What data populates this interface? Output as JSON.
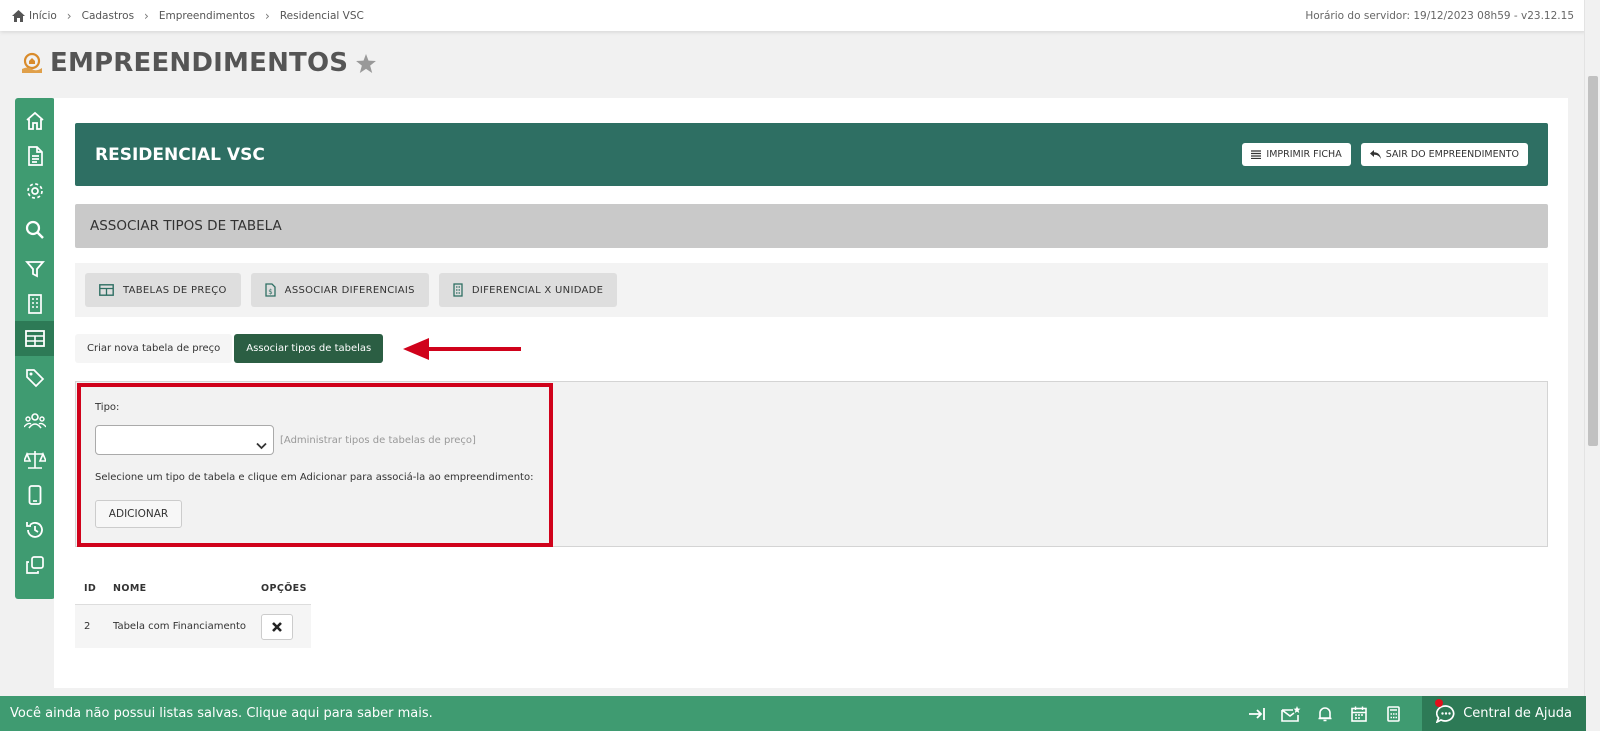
{
  "breadcrumb": {
    "items": [
      "Início",
      "Cadastros",
      "Empreendimentos",
      "Residencial VSC"
    ],
    "server_time": "Horário do servidor: 19/12/2023 08h59 - v23.12.15"
  },
  "page": {
    "title": "EMPREENDIMENTOS"
  },
  "sidebar": {
    "icons": [
      "home-icon",
      "document-icon",
      "gear-icon",
      "search-icon",
      "filter-icon",
      "building-icon",
      "table-icon",
      "tag-icon",
      "users-icon",
      "scale-icon",
      "mobile-icon",
      "history-icon",
      "copy-icon"
    ],
    "active_index": 6
  },
  "header": {
    "name": "RESIDENCIAL VSC",
    "print_label": "IMPRIMIR FICHA",
    "exit_label": "SAIR DO EMPREENDIMENTO"
  },
  "section": {
    "title": "ASSOCIAR TIPOS DE TABELA"
  },
  "tabs": {
    "price_tables": "TABELAS DE PREÇO",
    "associate_diff": "ASSOCIAR DIFERENCIAIS",
    "diff_unit": "DIFERENCIAL X UNIDADE"
  },
  "subtabs": {
    "create": "Criar nova tabela de preço",
    "associate": "Associar tipos de tabelas"
  },
  "form": {
    "tipo_label": "Tipo:",
    "tipo_value": "",
    "admin_link": "[Administrar tipos de tabelas de preço]",
    "help": "Selecione um tipo de tabela e clique em Adicionar para associá-la ao empreendimento:",
    "add_label": "ADICIONAR"
  },
  "table": {
    "headers": {
      "id": "ID",
      "name": "NOME",
      "options": "OPÇÕES"
    },
    "rows": [
      {
        "id": "2",
        "name": "Tabela com Financiamento"
      }
    ]
  },
  "bottombar": {
    "message": "Você ainda não possui listas salvas. Clique aqui para saber mais.",
    "help_label": "Central de Ajuda"
  },
  "colors": {
    "sidebar": "#3f9b71",
    "header": "#2e6f63",
    "active_subtab": "#2b5e43",
    "highlight": "#d0021b"
  }
}
